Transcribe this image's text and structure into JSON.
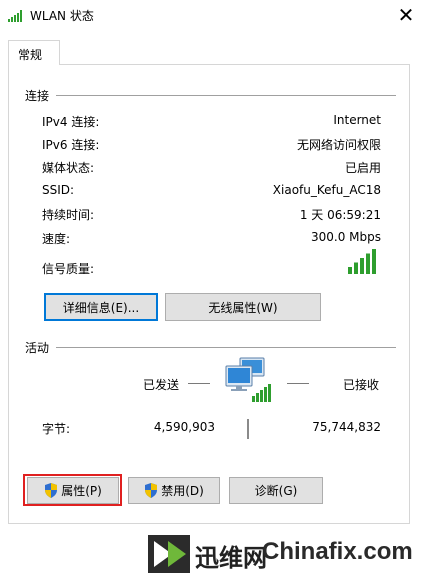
{
  "window": {
    "title": "WLAN 状态",
    "close_glyph": "✕"
  },
  "tabs": [
    {
      "label": "常规"
    }
  ],
  "connection": {
    "group_label": "连接",
    "rows": [
      {
        "label": "IPv4 连接:",
        "value": "Internet"
      },
      {
        "label": "IPv6 连接:",
        "value": "无网络访问权限"
      },
      {
        "label": "媒体状态:",
        "value": "已启用"
      },
      {
        "label": "SSID:",
        "value": "Xiaofu_Kefu_AC18"
      },
      {
        "label": "持续时间:",
        "value": "1 天 06:59:21"
      },
      {
        "label": "速度:",
        "value": "300.0 Mbps"
      }
    ],
    "signal_label": "信号质量:",
    "signal_bars": 5,
    "signal_max": 5,
    "details_button": "详细信息(E)...",
    "wireless_props_button": "无线属性(W)"
  },
  "activity": {
    "group_label": "活动",
    "sent_label": "已发送",
    "received_label": "已接收",
    "bytes_label": "字节:",
    "bytes_sent": "4,590,903",
    "bytes_received": "75,744,832"
  },
  "footer_buttons": {
    "properties": "属性(P)",
    "disable": "禁用(D)",
    "diagnose": "诊断(G)"
  },
  "watermark": {
    "brand_cn": "迅维网",
    "brand_en": "Chinafix.com"
  },
  "colors": {
    "signal_green": "#2e9e2e",
    "focus_blue": "#0078d7",
    "highlight_red": "#e02020",
    "shield_blue": "#2f6fd0",
    "shield_yellow": "#f2c200"
  }
}
